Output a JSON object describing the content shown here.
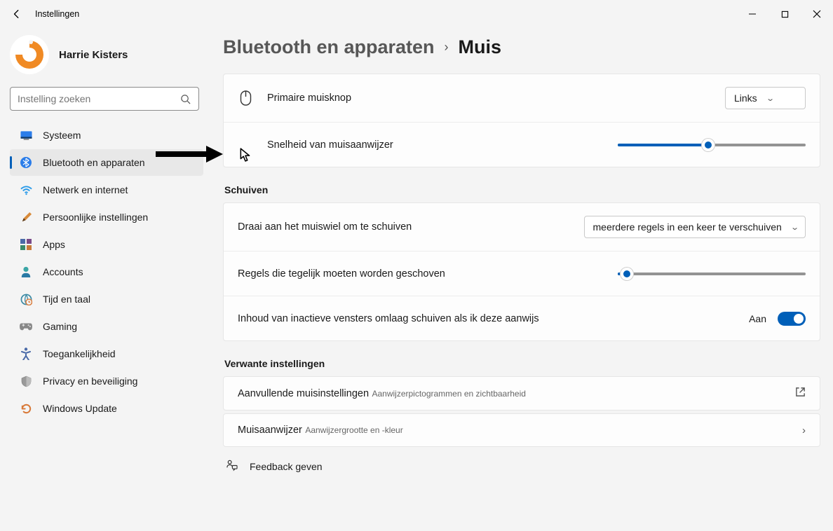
{
  "titlebar": {
    "title": "Instellingen"
  },
  "user": {
    "name": "Harrie Kisters"
  },
  "search": {
    "placeholder": "Instelling zoeken"
  },
  "sidebar": {
    "items": [
      {
        "label": "Systeem"
      },
      {
        "label": "Bluetooth en apparaten"
      },
      {
        "label": "Netwerk en internet"
      },
      {
        "label": "Persoonlijke instellingen"
      },
      {
        "label": "Apps"
      },
      {
        "label": "Accounts"
      },
      {
        "label": "Tijd en taal"
      },
      {
        "label": "Gaming"
      },
      {
        "label": "Toegankelijkheid"
      },
      {
        "label": "Privacy en beveiliging"
      },
      {
        "label": "Windows Update"
      }
    ]
  },
  "breadcrumb": {
    "parent": "Bluetooth en apparaten",
    "current": "Muis"
  },
  "settings": {
    "primary_button": {
      "label": "Primaire muisknop",
      "value": "Links"
    },
    "pointer_speed": {
      "label": "Snelheid van muisaanwijzer",
      "value_percent": 48
    },
    "scroll_heading": "Schuiven",
    "scroll_wheel": {
      "label": "Draai aan het muiswiel om te schuiven",
      "value": "meerdere regels in een keer te verschuiven"
    },
    "lines_at_once": {
      "label": "Regels die tegelijk moeten worden geschoven",
      "value_percent": 5
    },
    "inactive_scroll": {
      "label": "Inhoud van inactieve vensters omlaag schuiven als ik deze aanwijs",
      "value_label": "Aan"
    },
    "related_heading": "Verwante instellingen",
    "extra_mouse": {
      "title": "Aanvullende muisinstellingen",
      "sub": "Aanwijzerpictogrammen en zichtbaarheid"
    },
    "pointer": {
      "title": "Muisaanwijzer",
      "sub": "Aanwijzergrootte en -kleur"
    },
    "feedback": "Feedback geven"
  }
}
